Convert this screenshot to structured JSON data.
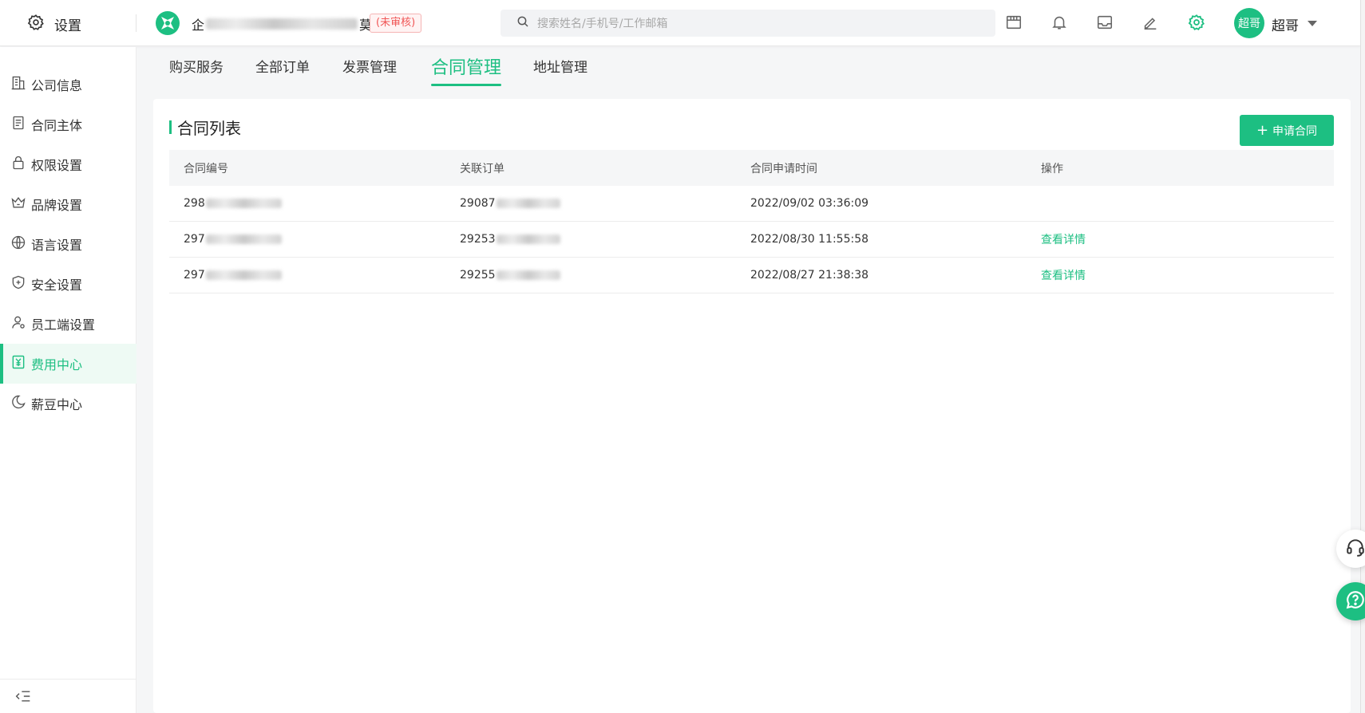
{
  "header": {
    "settings_label": "设置",
    "company_prefix": "企",
    "company_suffix": "莫",
    "status_badge": "(未审核)",
    "search_placeholder": "搜索姓名/手机号/工作邮箱",
    "user_avatar_text": "超哥",
    "user_name": "超哥"
  },
  "sidebar": {
    "items": [
      {
        "label": "公司信息",
        "icon": "building-icon"
      },
      {
        "label": "合同主体",
        "icon": "document-icon"
      },
      {
        "label": "权限设置",
        "icon": "lock-icon"
      },
      {
        "label": "品牌设置",
        "icon": "crown-icon"
      },
      {
        "label": "语言设置",
        "icon": "globe-icon"
      },
      {
        "label": "安全设置",
        "icon": "shield-icon"
      },
      {
        "label": "员工端设置",
        "icon": "user-icon"
      },
      {
        "label": "费用中心",
        "icon": "yuan-icon",
        "active": true
      },
      {
        "label": "薪豆中心",
        "icon": "bean-icon"
      }
    ]
  },
  "tabs": [
    {
      "label": "购买服务"
    },
    {
      "label": "全部订单"
    },
    {
      "label": "发票管理"
    },
    {
      "label": "合同管理",
      "active": true
    },
    {
      "label": "地址管理"
    }
  ],
  "contracts": {
    "title": "合同列表",
    "apply_button": "申请合同",
    "columns": [
      "合同编号",
      "关联订单",
      "合同申请时间",
      "操作"
    ],
    "rows": [
      {
        "id_prefix": "298",
        "order_prefix": "29087",
        "time": "2022/09/02 03:36:09",
        "action": ""
      },
      {
        "id_prefix": "297",
        "order_prefix": "29253",
        "time": "2022/08/30 11:55:58",
        "action": "查看详情"
      },
      {
        "id_prefix": "297",
        "order_prefix": "29255",
        "time": "2022/08/27 21:38:38",
        "action": "查看详情"
      }
    ]
  },
  "colors": {
    "accent": "#1dbf82",
    "badge_red": "#f05656"
  }
}
